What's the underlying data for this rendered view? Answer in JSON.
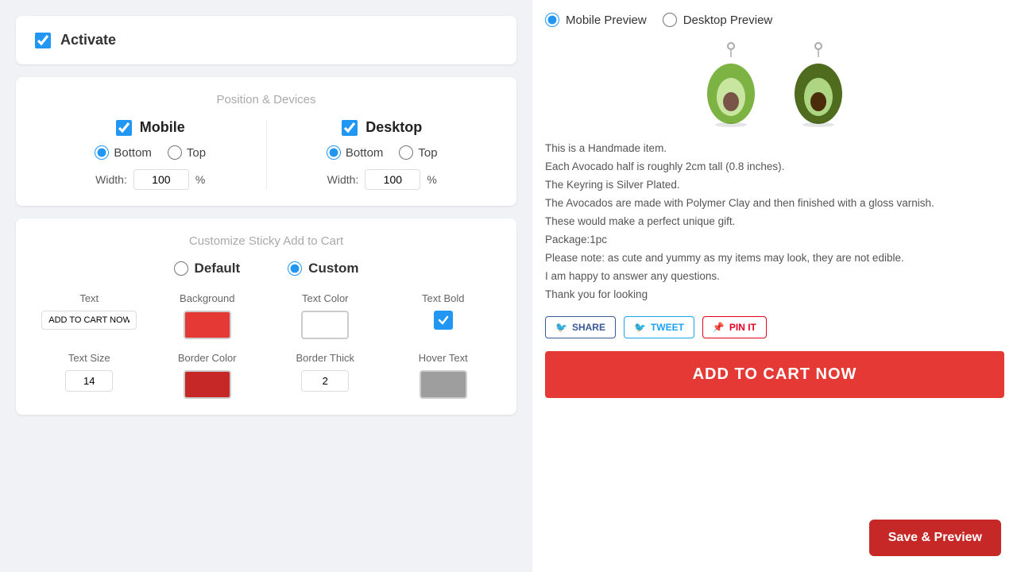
{
  "left": {
    "activate": {
      "label": "Activate",
      "checked": true
    },
    "position": {
      "title": "Position & Devices",
      "mobile": {
        "label": "Mobile",
        "checked": true,
        "position": "bottom",
        "options": [
          "Bottom",
          "Top"
        ],
        "width_label": "Width:",
        "width_value": "100",
        "width_unit": "%"
      },
      "desktop": {
        "label": "Desktop",
        "checked": true,
        "position": "bottom",
        "options": [
          "Bottom",
          "Top"
        ],
        "width_label": "Width:",
        "width_value": "100",
        "width_unit": "%"
      }
    },
    "customize": {
      "title": "Customize Sticky Add to Cart",
      "type": "custom",
      "options": [
        "Default",
        "Custom"
      ],
      "fields": {
        "text": {
          "label": "Text",
          "value": "ADD TO CART NOW"
        },
        "background": {
          "label": "Background",
          "color": "#e53935"
        },
        "text_color": {
          "label": "Text Color",
          "color": "#ffffff"
        },
        "text_bold": {
          "label": "Text Bold",
          "checked": true
        },
        "text_size": {
          "label": "Text Size",
          "value": "14"
        },
        "border_color": {
          "label": "Border Color",
          "color": "#c62828"
        },
        "border_thick": {
          "label": "Border Thick",
          "value": "2"
        },
        "hover_text": {
          "label": "Hover Text",
          "color": "#9e9e9e"
        }
      }
    }
  },
  "right": {
    "preview_options": [
      "Mobile Preview",
      "Desktop Preview"
    ],
    "selected_preview": "Mobile Preview",
    "description_lines": [
      "This is a Handmade item.",
      "Each Avocado half is roughly 2cm tall (0.8 inches).",
      "The Keyring is Silver Plated.",
      "The Avocados are made with Polymer Clay and then finished with a gloss varnish.",
      "These would make a perfect unique gift.",
      "Package:1pc",
      "Please note: as cute and yummy as my items may look, they are not edible.",
      "I am happy to answer any questions.",
      "Thank you for looking"
    ],
    "social_buttons": [
      {
        "label": "SHARE",
        "type": "fb"
      },
      {
        "label": "TWEET",
        "type": "tw"
      },
      {
        "label": "PIN IT",
        "type": "pin"
      }
    ],
    "add_to_cart_label": "ADD TO CART NOW",
    "save_preview_label": "Save & Preview"
  }
}
